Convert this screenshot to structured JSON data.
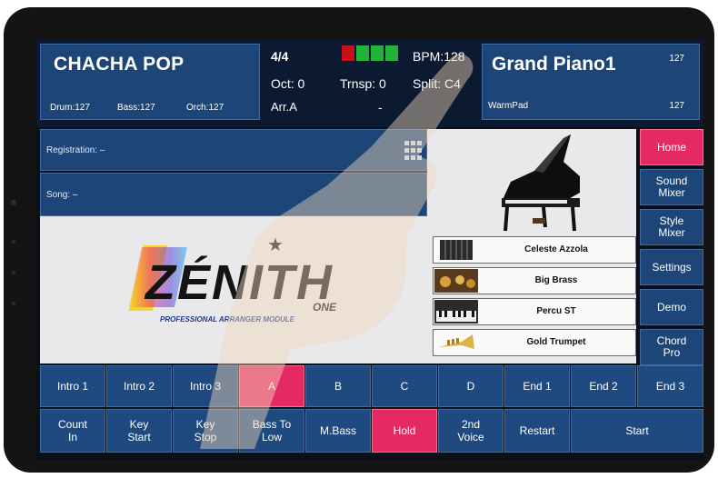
{
  "header": {
    "style_name": "CHACHA POP",
    "volumes": {
      "drum": "Drum:127",
      "bass": "Bass:127",
      "orch": "Orch:127"
    },
    "time_signature": "4/4",
    "octave": "Oct: 0",
    "arrangement": "Arr.A",
    "transpose": "Trnsp: 0",
    "bpm": "BPM:128",
    "split": "Split: C4",
    "dash": "-",
    "beat_led_colors": [
      "#c8101a",
      "#24b33a",
      "#24b33a",
      "#24b33a"
    ],
    "voice": {
      "name": "Grand Piano1",
      "volume": "127",
      "layer": "WarmPad",
      "layer_volume": "127"
    }
  },
  "registration_label": "Registration: –",
  "song_label": "Song: –",
  "logo": {
    "brand": "ZÉNITH",
    "sub": "ONE",
    "tagline": "PROFESSIONAL ARRANGER MODULE"
  },
  "voices": [
    {
      "label": "Celeste Azzola",
      "icon": "accordion-icon"
    },
    {
      "label": "Big Brass",
      "icon": "brass-icon"
    },
    {
      "label": "Percu ST",
      "icon": "keyboard-icon"
    },
    {
      "label": "Gold Trumpet",
      "icon": "trumpet-icon"
    }
  ],
  "side_menu": [
    {
      "label": "Home",
      "active": true
    },
    {
      "label": "Sound Mixer",
      "active": false
    },
    {
      "label": "Style Mixer",
      "active": false
    },
    {
      "label": "Settings",
      "active": false
    },
    {
      "label": "Demo",
      "active": false
    },
    {
      "label": "Chord Pro",
      "active": false
    }
  ],
  "style_buttons": [
    {
      "label": "Intro 1",
      "active": false
    },
    {
      "label": "Intro 2",
      "active": false
    },
    {
      "label": "Intro 3",
      "active": false
    },
    {
      "label": "A",
      "active": true
    },
    {
      "label": "B",
      "active": false
    },
    {
      "label": "C",
      "active": false
    },
    {
      "label": "D",
      "active": false
    },
    {
      "label": "End 1",
      "active": false
    },
    {
      "label": "End 2",
      "active": false
    },
    {
      "label": "End 3",
      "active": false
    }
  ],
  "control_buttons": [
    {
      "label": "Count In",
      "active": false
    },
    {
      "label": "Key Start",
      "active": false
    },
    {
      "label": "Key Stop",
      "active": false
    },
    {
      "label": "Bass To Low",
      "active": false
    },
    {
      "label": "M.Bass",
      "active": false
    },
    {
      "label": "Hold",
      "active": true
    },
    {
      "label": "2nd Voice",
      "active": false
    },
    {
      "label": "Restart",
      "active": false
    },
    {
      "label": "Start",
      "active": false
    }
  ],
  "colors": {
    "accent_pink": "#e52a63",
    "panel_blue": "#1d4577",
    "led_red": "#c8101a",
    "led_green": "#24b33a"
  }
}
